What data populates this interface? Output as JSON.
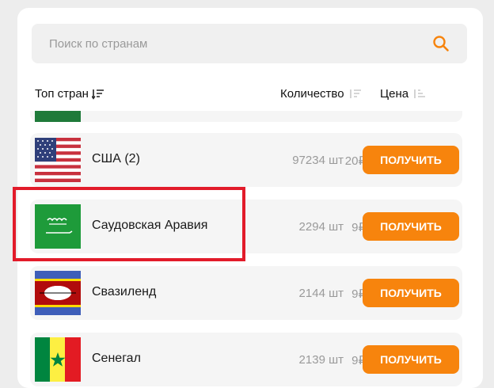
{
  "search": {
    "placeholder": "Поиск по странам"
  },
  "header": {
    "top_label": "Топ стран",
    "quantity_label": "Количество",
    "price_label": "Цена"
  },
  "rows": [
    {
      "name": "США (2)",
      "quantity": "97234 шт",
      "price": "20₽",
      "button": "ПОЛУЧИТЬ",
      "flag": "usa-flag"
    },
    {
      "name": "Саудовская Аравия",
      "quantity": "2294 шт",
      "price": "9₽",
      "button": "ПОЛУЧИТЬ",
      "flag": "saudi-arabia-flag"
    },
    {
      "name": "Свазиленд",
      "quantity": "2144 шт",
      "price": "9₽",
      "button": "ПОЛУЧИТЬ",
      "flag": "eswatini-flag"
    },
    {
      "name": "Сенегал",
      "quantity": "2139 шт",
      "price": "9₽",
      "button": "ПОЛУЧИТЬ",
      "flag": "senegal-flag"
    }
  ],
  "colors": {
    "accent": "#f7840d",
    "highlight": "#e21b2a",
    "sort_active": "#f5a84c"
  }
}
